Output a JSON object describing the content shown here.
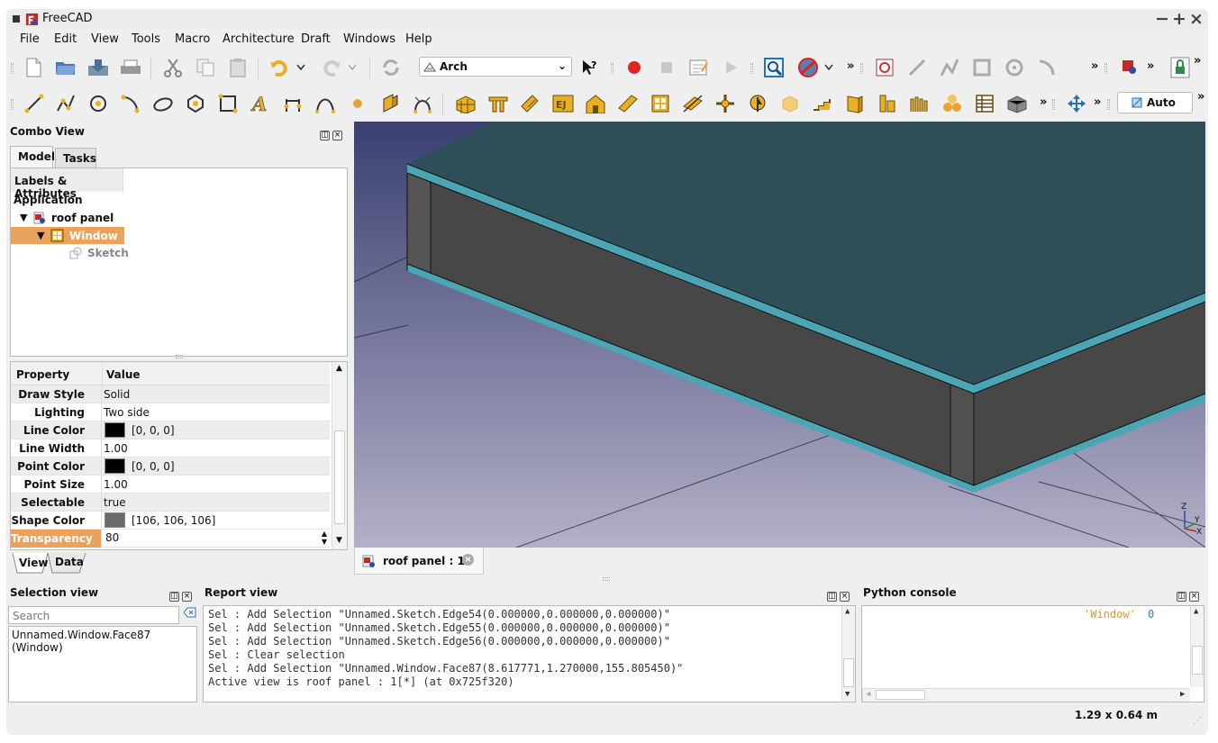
{
  "window": {
    "title": "FreeCAD"
  },
  "menu": [
    "File",
    "Edit",
    "View",
    "Tools",
    "Macro",
    "Architecture",
    "Draft",
    "Windows",
    "Help"
  ],
  "toolbar": {
    "workbench": "Arch",
    "draw_style": "Auto",
    "overflow": "»"
  },
  "combo_view": {
    "title": "Combo View",
    "tabs": [
      "Model",
      "Tasks"
    ],
    "tree_header": "Labels & Attributes",
    "tree": {
      "root": "Application",
      "items": [
        {
          "label": "roof panel"
        },
        {
          "label": "Window"
        },
        {
          "label": "Sketch"
        }
      ]
    },
    "property_header": {
      "property": "Property",
      "value": "Value"
    },
    "properties": [
      {
        "name": "Draw Style",
        "value": "Solid"
      },
      {
        "name": "Lighting",
        "value": "Two side"
      },
      {
        "name": "Line Color",
        "value": "[0, 0, 0]",
        "color": "#000000"
      },
      {
        "name": "Line Width",
        "value": "1.00"
      },
      {
        "name": "Point Color",
        "value": "[0, 0, 0]",
        "color": "#000000"
      },
      {
        "name": "Point Size",
        "value": "1.00"
      },
      {
        "name": "Selectable",
        "value": "true"
      },
      {
        "name": "Shape Color",
        "value": "[106, 106, 106]",
        "color": "#6a6a6a"
      },
      {
        "name": "Transparency",
        "value": "80"
      }
    ],
    "bottom_tabs": [
      "View",
      "Data"
    ]
  },
  "document_tab": {
    "label": "roof panel : 1*"
  },
  "axis_labels": {
    "z": "Z",
    "y": "Y",
    "x": "X"
  },
  "selection_view": {
    "title": "Selection view",
    "search_placeholder": "Search",
    "items": [
      "Unnamed.Window.Face87 (Window)"
    ]
  },
  "report_view": {
    "title": "Report view",
    "lines": [
      "Sel : Add Selection \"Unnamed.Sketch.Edge54(0.000000,0.000000,0.000000)\"",
      "Sel : Add Selection \"Unnamed.Sketch.Edge55(0.000000,0.000000,0.000000)\"",
      "Sel : Add Selection \"Unnamed.Sketch.Edge56(0.000000,0.000000,0.000000)\"",
      "Sel : Clear selection",
      "Sel : Add Selection \"Unnamed.Window.Face87(8.617771,1.270000,155.805450)\"",
      "Active view is roof panel : 1[*] (at 0x725f320)"
    ]
  },
  "python_console": {
    "title": "Python console",
    "string_token": "'Window'",
    "number_token": "0"
  },
  "status": {
    "dimensions": "1.29 x 0.64 m"
  },
  "colors": {
    "selection": "#e9a35c",
    "roof_top": "#2e4f57",
    "roof_edge": "#4aa6b5",
    "side_face": "#474747",
    "viewport_top": "#3a3f70",
    "viewport_bottom": "#b3b0c8"
  }
}
